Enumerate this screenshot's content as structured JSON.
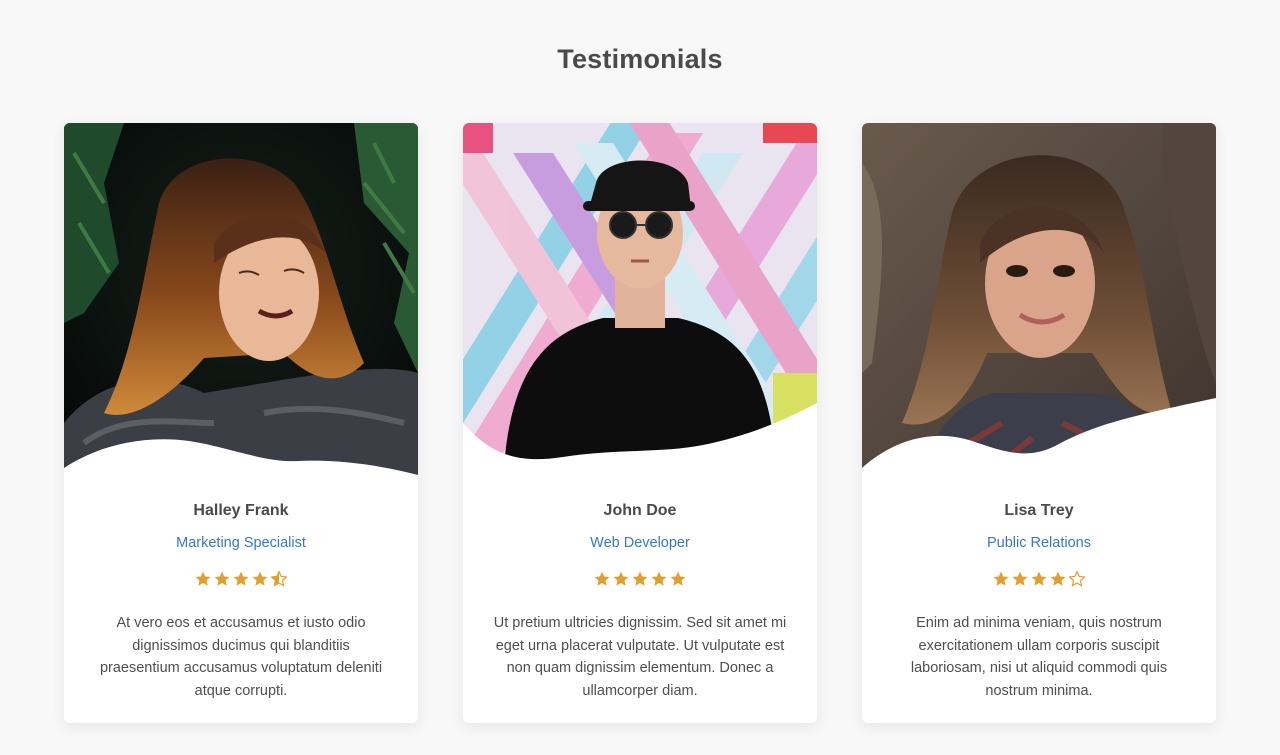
{
  "page": {
    "title": "Testimonials"
  },
  "colors": {
    "accent": "#3a78c4",
    "star": "#e0a030",
    "text": "#4a4a4a",
    "background": "#f8f8f8"
  },
  "testimonials": [
    {
      "name": "Halley Frank",
      "role": "Marketing Specialist",
      "rating": 4.5,
      "quote": "At vero eos et accusamus et iusto odio dignissimos ducimus qui blanditiis praesentium accusamus voluptatum deleniti atque corrupti."
    },
    {
      "name": "John Doe",
      "role": "Web Developer",
      "rating": 5,
      "quote": "Ut pretium ultricies dignissim. Sed sit amet mi eget urna placerat vulputate. Ut vulputate est non quam dignissim elementum. Donec a ullamcorper diam."
    },
    {
      "name": "Lisa Trey",
      "role": "Public Relations",
      "rating": 4,
      "quote": "Enim ad minima veniam, quis nostrum exercitationem ullam corporis suscipit laboriosam, nisi ut aliquid commodi quis nostrum minima."
    }
  ]
}
